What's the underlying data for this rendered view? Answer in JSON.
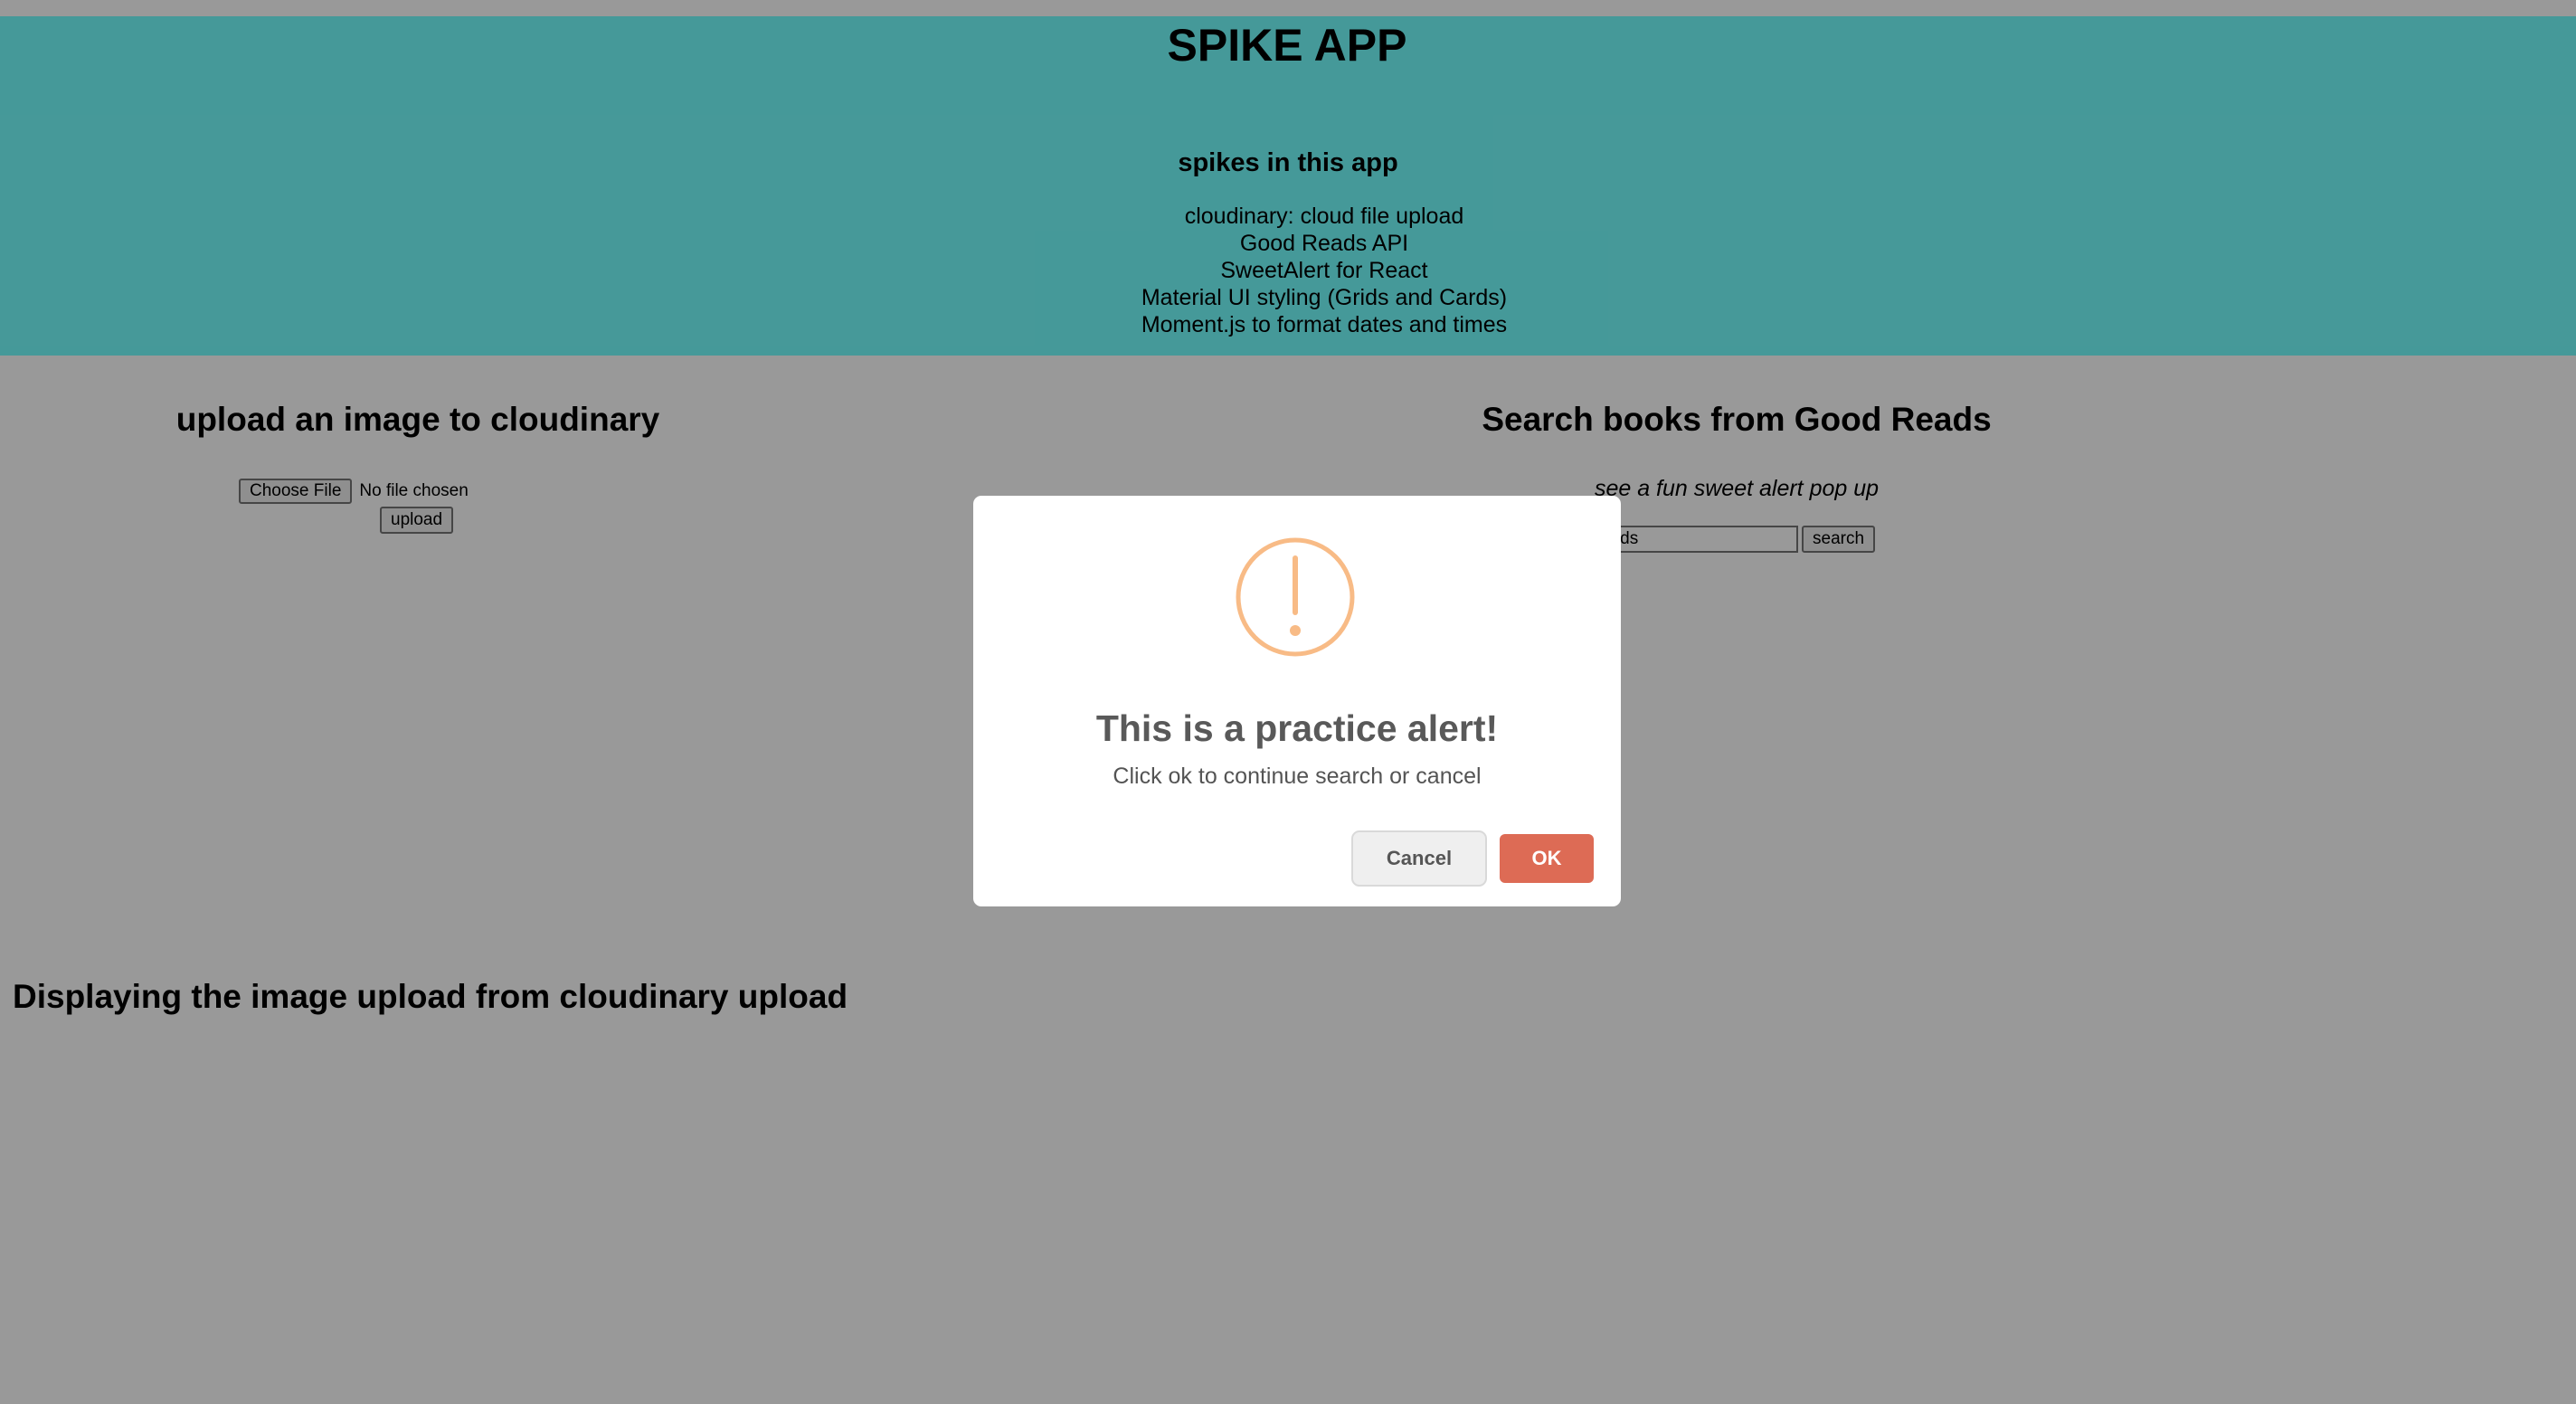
{
  "header": {
    "title": "SPIKE APP",
    "spikes_heading": "spikes in this app",
    "spikes": [
      "cloudinary: cloud file upload",
      "Good Reads API",
      "SweetAlert for React",
      "Material UI styling (Grids and Cards)",
      "Moment.js to format dates and times"
    ]
  },
  "upload": {
    "title": "upload an image to cloudinary",
    "choose_file_label": "Choose File",
    "file_status": "No file chosen",
    "upload_label": "upload"
  },
  "search": {
    "title": "Search books from Good Reads",
    "subtitle": "see a fun sweet alert pop up",
    "input_value": "ouds",
    "search_label": "search"
  },
  "display": {
    "title": "Displaying the image upload from cloudinary upload"
  },
  "alert": {
    "icon": "exclamation-circle-icon",
    "title": "This is a practice alert!",
    "text": "Click ok to continue search or cancel",
    "cancel_label": "Cancel",
    "ok_label": "OK"
  },
  "colors": {
    "header_bg": "#74ffff",
    "ok_button": "#dd6b55",
    "warning_icon": "#f8bb86",
    "overlay": "rgba(0,0,0,0.4)"
  }
}
